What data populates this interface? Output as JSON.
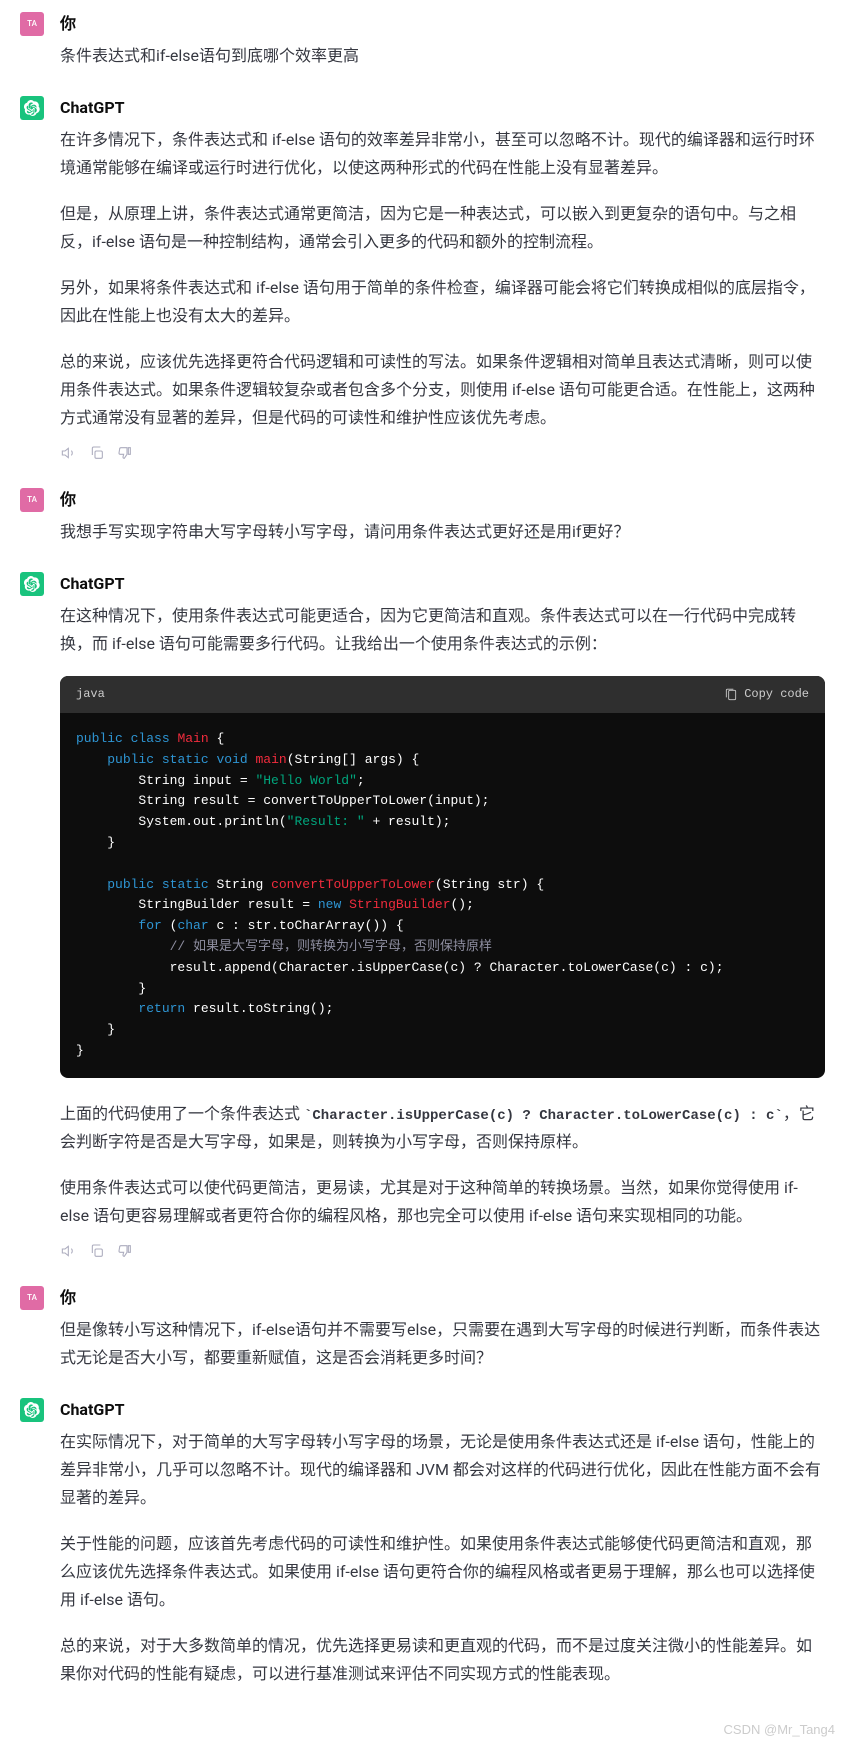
{
  "user_avatar_label": "TA",
  "user_name": "你",
  "ai_name": "ChatGPT",
  "messages": {
    "q1": "条件表达式和if-else语句到底哪个效率更高",
    "a1_p1": "在许多情况下，条件表达式和 if-else 语句的效率差异非常小，甚至可以忽略不计。现代的编译器和运行时环境通常能够在编译或运行时进行优化，以使这两种形式的代码在性能上没有显著差异。",
    "a1_p2": "但是，从原理上讲，条件表达式通常更简洁，因为它是一种表达式，可以嵌入到更复杂的语句中。与之相反，if-else 语句是一种控制结构，通常会引入更多的代码和额外的控制流程。",
    "a1_p3": "另外，如果将条件表达式和 if-else 语句用于简单的条件检查，编译器可能会将它们转换成相似的底层指令，因此在性能上也没有太大的差异。",
    "a1_p4": "总的来说，应该优先选择更符合代码逻辑和可读性的写法。如果条件逻辑相对简单且表达式清晰，则可以使用条件表达式。如果条件逻辑较复杂或者包含多个分支，则使用 if-else 语句可能更合适。在性能上，这两种方式通常没有显著的差异，但是代码的可读性和维护性应该优先考虑。",
    "q2": "我想手写实现字符串大写字母转小写字母，请问用条件表达式更好还是用if更好？",
    "a2_p1": "在这种情况下，使用条件表达式可能更适合，因为它更简洁和直观。条件表达式可以在一行代码中完成转换，而 if-else 语句可能需要多行代码。让我给出一个使用条件表达式的示例：",
    "a2_p2_pre": "上面的代码使用了一个条件表达式 ",
    "a2_p2_code": "`Character.isUpperCase(c) ? Character.toLowerCase(c) : c`",
    "a2_p2_post": "，它会判断字符是否是大写字母，如果是，则转换为小写字母，否则保持原样。",
    "a2_p3": "使用条件表达式可以使代码更简洁，更易读，尤其是对于这种简单的转换场景。当然，如果你觉得使用 if-else 语句更容易理解或者更符合你的编程风格，那也完全可以使用 if-else 语句来实现相同的功能。",
    "q3_p1": "但是像转小写这种情况下，if-else语句并不需要写else，只需要在遇到大写字母的时候进行判断，而条件表达式无论是否大小写，都要重新赋值，这是否会消耗更多时间？",
    "a3_p1": "在实际情况下，对于简单的大写字母转小写字母的场景，无论是使用条件表达式还是 if-else 语句，性能上的差异非常小，几乎可以忽略不计。现代的编译器和 JVM 都会对这样的代码进行优化，因此在性能方面不会有显著的差异。",
    "a3_p2": "关于性能的问题，应该首先考虑代码的可读性和维护性。如果使用条件表达式能够使代码更简洁和直观，那么应该优先选择条件表达式。如果使用 if-else 语句更符合你的编程风格或者更易于理解，那么也可以选择使用 if-else 语句。",
    "a3_p3": "总的来说，对于大多数简单的情况，优先选择更易读和更直观的代码，而不是过度关注微小的性能差异。如果你对代码的性能有疑虑，可以进行基准测试来评估不同实现方式的性能表现。"
  },
  "code": {
    "lang": "java",
    "copy_label": "Copy code",
    "tokens": [
      {
        "t": "public",
        "c": "tok-kw"
      },
      {
        "t": " ",
        "c": ""
      },
      {
        "t": "class",
        "c": "tok-kw"
      },
      {
        "t": " ",
        "c": ""
      },
      {
        "t": "Main",
        "c": "tok-fn"
      },
      {
        "t": " {\n",
        "c": ""
      },
      {
        "t": "    ",
        "c": ""
      },
      {
        "t": "public",
        "c": "tok-kw"
      },
      {
        "t": " ",
        "c": ""
      },
      {
        "t": "static",
        "c": "tok-kw"
      },
      {
        "t": " ",
        "c": ""
      },
      {
        "t": "void",
        "c": "tok-kw"
      },
      {
        "t": " ",
        "c": ""
      },
      {
        "t": "main",
        "c": "tok-fn"
      },
      {
        "t": "(String[] args) {\n",
        "c": ""
      },
      {
        "t": "        String ",
        "c": ""
      },
      {
        "t": "input",
        "c": "tok-id"
      },
      {
        "t": " = ",
        "c": ""
      },
      {
        "t": "\"Hello World\"",
        "c": "tok-str"
      },
      {
        "t": ";\n",
        "c": ""
      },
      {
        "t": "        String ",
        "c": ""
      },
      {
        "t": "result",
        "c": "tok-id"
      },
      {
        "t": " = convertToUpperToLower(input);\n",
        "c": ""
      },
      {
        "t": "        System.out.println(",
        "c": ""
      },
      {
        "t": "\"Result: \"",
        "c": "tok-str"
      },
      {
        "t": " + result);\n",
        "c": ""
      },
      {
        "t": "    }\n\n",
        "c": ""
      },
      {
        "t": "    ",
        "c": ""
      },
      {
        "t": "public",
        "c": "tok-kw"
      },
      {
        "t": " ",
        "c": ""
      },
      {
        "t": "static",
        "c": "tok-kw"
      },
      {
        "t": " String ",
        "c": ""
      },
      {
        "t": "convertToUpperToLower",
        "c": "tok-fn"
      },
      {
        "t": "(String str) {\n",
        "c": ""
      },
      {
        "t": "        StringBuilder ",
        "c": ""
      },
      {
        "t": "result",
        "c": "tok-id"
      },
      {
        "t": " = ",
        "c": ""
      },
      {
        "t": "new",
        "c": "tok-kw"
      },
      {
        "t": " ",
        "c": ""
      },
      {
        "t": "StringBuilder",
        "c": "tok-fn"
      },
      {
        "t": "();\n",
        "c": ""
      },
      {
        "t": "        ",
        "c": ""
      },
      {
        "t": "for",
        "c": "tok-kw"
      },
      {
        "t": " (",
        "c": ""
      },
      {
        "t": "char",
        "c": "tok-kw"
      },
      {
        "t": " c : str.toCharArray()) {\n",
        "c": ""
      },
      {
        "t": "            ",
        "c": ""
      },
      {
        "t": "// 如果是大写字母，则转换为小写字母，否则保持原样\n",
        "c": "tok-cmt"
      },
      {
        "t": "            result.append(Character.isUpperCase(c) ? Character.toLowerCase(c) : c);\n",
        "c": ""
      },
      {
        "t": "        }\n",
        "c": ""
      },
      {
        "t": "        ",
        "c": ""
      },
      {
        "t": "return",
        "c": "tok-kw"
      },
      {
        "t": " result.toString();\n",
        "c": ""
      },
      {
        "t": "    }\n",
        "c": ""
      },
      {
        "t": "}\n",
        "c": ""
      }
    ]
  },
  "watermark": "CSDN @Mr_Tang4"
}
